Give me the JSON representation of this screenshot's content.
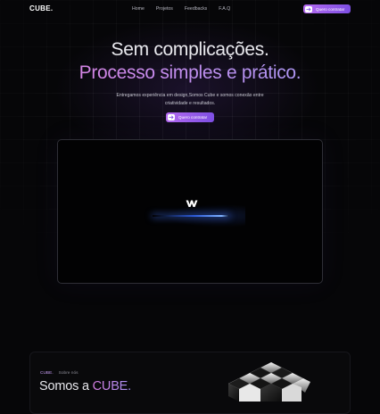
{
  "nav": {
    "logo": "CUBE.",
    "links": [
      "Home",
      "Projetos",
      "Feedbacks",
      "F.A.Q"
    ],
    "cta_label": "Quero contratar"
  },
  "hero": {
    "title_line1": "Sem complicações.",
    "title_line2": "Processo simples e prático.",
    "subtitle": "Entregamos experiência em design,Somos Cube e somos conexão entre criatividade e resultados.",
    "cta_label": "Quero contratar"
  },
  "video": {
    "icon": "webflow-w-icon"
  },
  "about": {
    "brand": "CUBE.",
    "label": "Sobre nós",
    "title_prefix": "Somos a ",
    "title_highlight": "CUBE."
  },
  "colors": {
    "accent_start": "#b56bf0",
    "accent_end": "#7d4fe3",
    "background": "#060608"
  }
}
